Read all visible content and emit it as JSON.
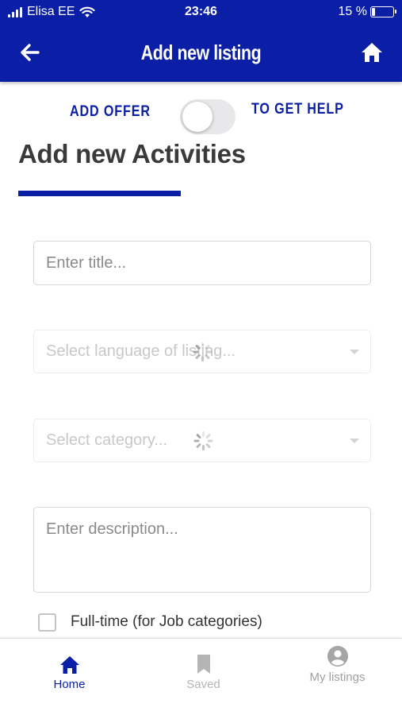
{
  "status_bar": {
    "carrier": "Elisa EE",
    "time": "23:46",
    "battery_percent": "15 %",
    "battery_level": 0.15
  },
  "header": {
    "title": "Add new listing",
    "back_icon": "arrow-left-icon",
    "home_icon": "home-icon"
  },
  "toggle": {
    "left_label": "ADD OFFER",
    "right_label": "TO GET HELP",
    "checked": false
  },
  "form": {
    "heading": "Add new Activities",
    "title_placeholder": "Enter title...",
    "language_placeholder": "Select language of listing...",
    "category_placeholder": "Select category...",
    "description_placeholder": "Enter description...",
    "fulltime_label": "Full-time (for Job categories)"
  },
  "tabbar": {
    "tabs": [
      {
        "label": "Home",
        "icon": "home-icon",
        "active": true
      },
      {
        "label": "Saved",
        "icon": "bookmark-icon",
        "active": false
      },
      {
        "label": "My listings",
        "icon": "user-circle-icon",
        "active": false
      }
    ]
  },
  "colors": {
    "primary": "#0a1fa6",
    "inactive_tab": "#9a9a9a",
    "placeholder": "#8a8a8a",
    "disabled_placeholder": "#c8c8c8"
  }
}
